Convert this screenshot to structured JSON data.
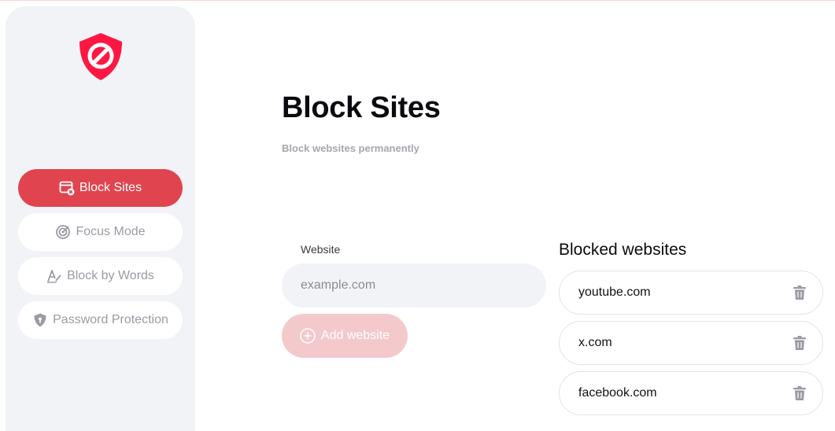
{
  "sidebar": {
    "logo_icon": "shield-block-icon",
    "items": [
      {
        "label": "Block Sites",
        "icon": "browser-block-icon",
        "active": true
      },
      {
        "label": "Focus Mode",
        "icon": "target-icon",
        "active": false
      },
      {
        "label": "Block by Words",
        "icon": "signature-pen-icon",
        "active": false
      },
      {
        "label": "Password Protection",
        "icon": "shield-lock-icon",
        "active": false
      }
    ]
  },
  "main": {
    "title": "Block Sites",
    "subtitle": "Block websites permanently",
    "form": {
      "label": "Website",
      "placeholder": "example.com",
      "value": "",
      "add_label": "Add website"
    },
    "blocked": {
      "title": "Blocked websites",
      "sites": [
        "youtube.com",
        "x.com",
        "facebook.com"
      ]
    }
  },
  "colors": {
    "accent": "#e0444f",
    "accent_disabled": "#f3c9cc",
    "sidebar_bg": "#f2f3f7",
    "muted_text": "#9a9ba3"
  }
}
